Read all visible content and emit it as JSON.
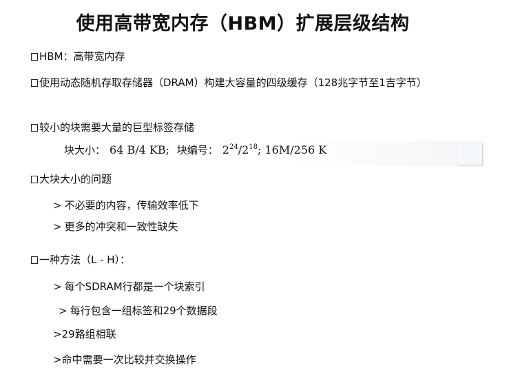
{
  "title": "使用高带宽内存（HBM）扩展层级结构",
  "items": {
    "hbm": "HBM：高带宽内存",
    "dram": "使用动态随机存取存储器（DRAM）构建大容量的四级缓存（128兆字节至1吉字节）",
    "small_block": "较小的块需要大量的巨型标签存储",
    "big_block": "大块大小的问题",
    "approach": "一种方法（L - H）："
  },
  "formula": {
    "block_size_label": "块大小：",
    "block_size_value": "64 B/4 KB;",
    "block_num_label": "块编号：",
    "base1": "2",
    "exp1": "24",
    "slash": "/",
    "base2": "2",
    "exp2": "18",
    "tail": "; 16M/256 K"
  },
  "big_block_subs": {
    "s1": "不必要的内容，传输效率低下",
    "s2": "更多的冲突和一致性缺失"
  },
  "approach_subs": {
    "a1": "每个SDRAM行都是一个块索引",
    "a2": "每行包含一组标签和29个数据段",
    "a3": ">29路组相联",
    "a4": ">命中需要一次比较并交换操作"
  },
  "symbols": {
    "gt": ">"
  }
}
